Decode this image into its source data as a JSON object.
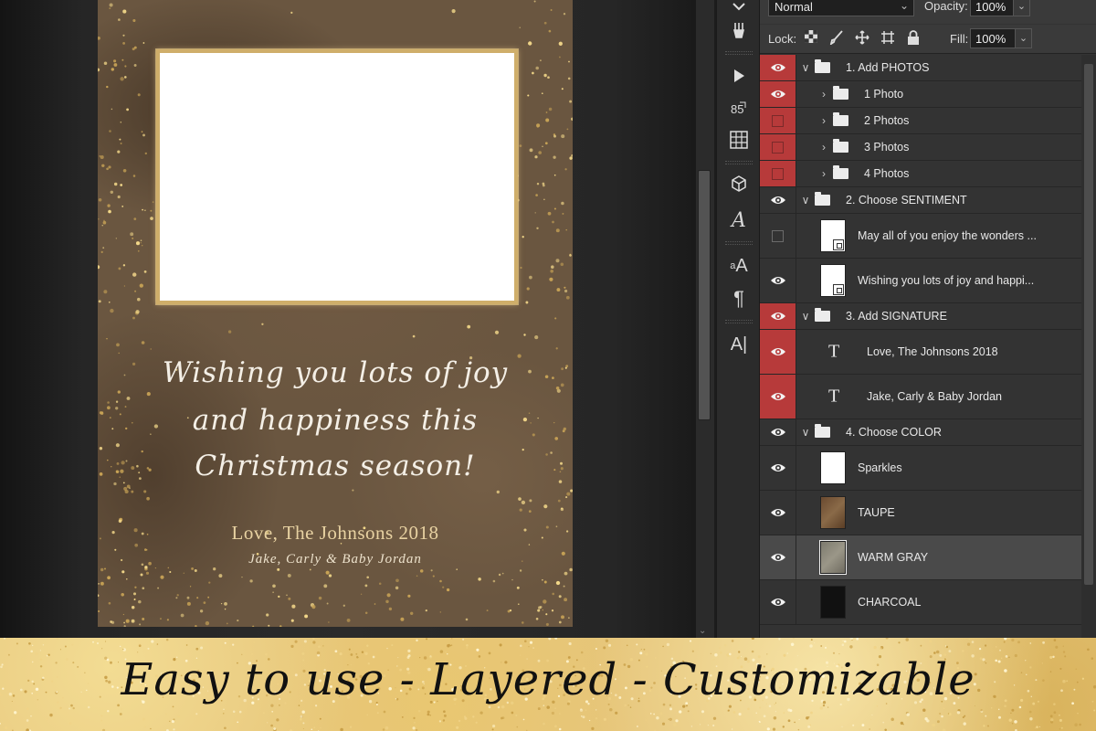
{
  "card": {
    "sentiment": [
      "Wishing you lots of joy",
      "and happiness this",
      "Christmas season!"
    ],
    "signature": "Love, The Johnsons 2018",
    "names": "Jake, Carly & Baby Jordan"
  },
  "options_bar": {
    "blend_mode": "Normal",
    "opacity_label": "Opacity:",
    "opacity_value": "100%",
    "lock_label": "Lock:",
    "fill_label": "Fill:",
    "fill_value": "100%"
  },
  "tools": [
    "play-icon",
    "history-brush-icon",
    "grid-icon",
    "3d-cube-icon",
    "character-icon",
    "paragraph-style-icon",
    "paragraph-icon",
    "text-cursor-icon"
  ],
  "layers": [
    {
      "name": "1. Add PHOTOS",
      "kind": "group",
      "indent": 0,
      "expanded": true,
      "visible": true,
      "highlight": true
    },
    {
      "name": "1 Photo",
      "kind": "group",
      "indent": 1,
      "expanded": false,
      "visible": true,
      "highlight": true
    },
    {
      "name": "2 Photos",
      "kind": "group",
      "indent": 1,
      "expanded": false,
      "visible": false,
      "highlight": true
    },
    {
      "name": "3 Photos",
      "kind": "group",
      "indent": 1,
      "expanded": false,
      "visible": false,
      "highlight": true
    },
    {
      "name": "4 Photos",
      "kind": "group",
      "indent": 1,
      "expanded": false,
      "visible": false,
      "highlight": true
    },
    {
      "name": "2. Choose SENTIMENT",
      "kind": "group",
      "indent": 0,
      "expanded": true,
      "visible": true,
      "highlight": false
    },
    {
      "name": "May all of you enjoy the wonders ...",
      "kind": "smart",
      "indent": 1,
      "visible": false,
      "highlight": false
    },
    {
      "name": "Wishing you lots of joy and happi...",
      "kind": "smart",
      "indent": 1,
      "visible": true,
      "highlight": false
    },
    {
      "name": "3. Add SIGNATURE",
      "kind": "group",
      "indent": 0,
      "expanded": true,
      "visible": true,
      "highlight": true
    },
    {
      "name": "Love, The Johnsons 2018",
      "kind": "text",
      "indent": 1,
      "visible": true,
      "highlight": true
    },
    {
      "name": "Jake, Carly & Baby Jordan",
      "kind": "text",
      "indent": 1,
      "visible": true,
      "highlight": true
    },
    {
      "name": "4. Choose COLOR",
      "kind": "group",
      "indent": 0,
      "expanded": true,
      "visible": true,
      "highlight": false
    },
    {
      "name": "Sparkles",
      "kind": "image",
      "texture": "spark",
      "indent": 1,
      "visible": true,
      "highlight": false
    },
    {
      "name": "TAUPE",
      "kind": "image",
      "texture": "taupe",
      "indent": 1,
      "visible": true,
      "highlight": false
    },
    {
      "name": "WARM GRAY",
      "kind": "image",
      "texture": "gray",
      "indent": 1,
      "visible": true,
      "highlight": false,
      "selected": true
    },
    {
      "name": "CHARCOAL",
      "kind": "image",
      "texture": "char",
      "indent": 1,
      "visible": true,
      "highlight": false
    }
  ],
  "banner": {
    "tagline": "Easy to use - Layered - Customizable"
  },
  "colors": {
    "eye_highlight": "#b73a3a",
    "panel_bg": "#333333",
    "card_bg": "#6a5640",
    "gold": "#e6c57a"
  }
}
